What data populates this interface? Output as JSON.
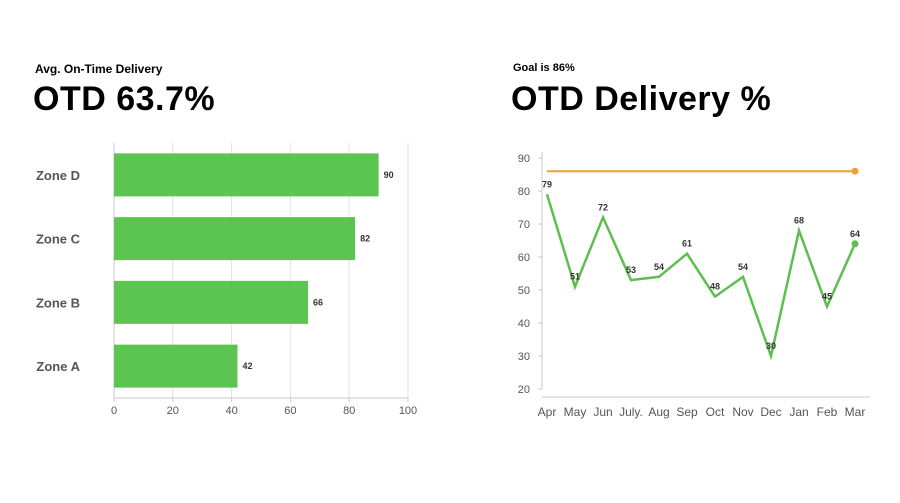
{
  "left": {
    "subtitle": "Avg. On-Time Delivery",
    "title": "OTD 63.7%"
  },
  "right": {
    "subtitle": "Goal is 86%",
    "title": "OTD Delivery %"
  },
  "colors": {
    "bar": "#5cc552",
    "line": "#5cbf4f",
    "goal": "#f0a030",
    "grid": "#e2e2e2",
    "axis": "#c8c8c8"
  },
  "chart_data": [
    {
      "type": "bar",
      "orientation": "horizontal",
      "categories": [
        "Zone D",
        "Zone C",
        "Zone B",
        "Zone A"
      ],
      "values": [
        90,
        82,
        66,
        42
      ],
      "xlim": [
        0,
        100
      ],
      "xticks": [
        0,
        20,
        40,
        60,
        80,
        100
      ],
      "grid": true,
      "data_labels": true
    },
    {
      "type": "line",
      "categories": [
        "Apr",
        "May",
        "Jun",
        "July.",
        "Aug",
        "Sep",
        "Oct",
        "Nov",
        "Dec",
        "Jan",
        "Feb",
        "Mar"
      ],
      "series": [
        {
          "values": [
            79,
            51,
            72,
            53,
            54,
            61,
            48,
            54,
            30,
            68,
            45,
            64
          ]
        },
        {
          "values": [
            86,
            86,
            86,
            86,
            86,
            86,
            86,
            86,
            86,
            86,
            86,
            86
          ]
        }
      ],
      "ylim": [
        20,
        90
      ],
      "yticks": [
        20,
        30,
        40,
        50,
        60,
        70,
        80,
        90
      ],
      "grid": false,
      "data_labels": true
    }
  ]
}
